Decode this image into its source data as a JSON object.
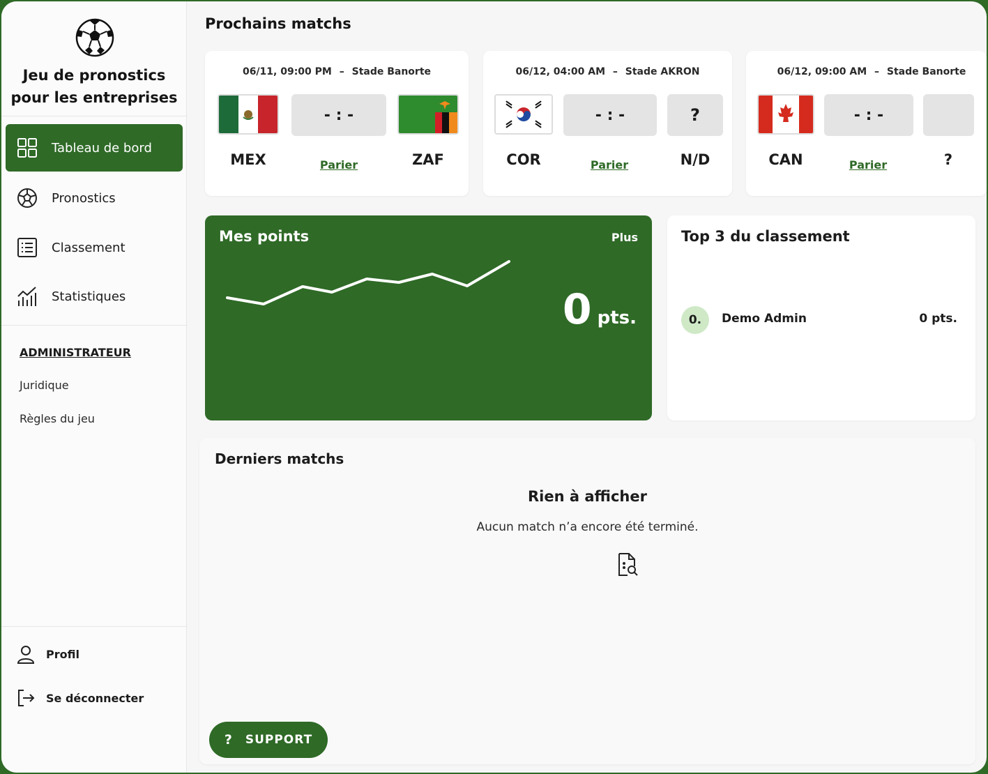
{
  "app": {
    "title_line1": "Jeu de pronostics",
    "title_line2": "pour les entreprises"
  },
  "nav": {
    "items": [
      {
        "label": "Tableau de bord",
        "icon": "dashboard-grid-icon",
        "active": true
      },
      {
        "label": "Pronostics",
        "icon": "soccer-ball-icon",
        "active": false
      },
      {
        "label": "Classement",
        "icon": "list-icon",
        "active": false
      },
      {
        "label": "Statistiques",
        "icon": "chart-icon",
        "active": false
      }
    ]
  },
  "admin": {
    "title": "ADMINISTRATEUR",
    "links": [
      "Juridique",
      "Règles du jeu"
    ]
  },
  "account": {
    "profile": "Profil",
    "logout": "Se déconnecter"
  },
  "upcoming": {
    "title": "Prochains matchs",
    "matches": [
      {
        "date": "06/11, 09:00 PM",
        "stadium": "Stade Banorte",
        "sep": "–",
        "home": "MEX",
        "away": "ZAF",
        "score": "- : -",
        "bet": "Parier"
      },
      {
        "date": "06/12, 04:00 AM",
        "stadium": "Stade AKRON",
        "sep": "–",
        "home": "COR",
        "away": "N/D",
        "score": "- : -",
        "bet": "Parier",
        "away_flag": "?"
      },
      {
        "date": "06/12, 09:00 AM",
        "stadium": "Stade Banorte",
        "sep": "–",
        "home": "CAN",
        "away": "?",
        "score": "- : -",
        "bet": "Parier"
      }
    ]
  },
  "points": {
    "title": "Mes points",
    "more": "Plus",
    "value": "0",
    "unit": "pts.",
    "color": "#2f6a27"
  },
  "top3": {
    "title": "Top 3 du classement",
    "entries": [
      {
        "rank": "0.",
        "name": "Demo Admin",
        "points": "0 pts."
      }
    ]
  },
  "last": {
    "title": "Derniers matchs",
    "empty_title": "Rien à afficher",
    "empty_text": "Aucun match n’a encore été terminé."
  },
  "support": {
    "label": "SUPPORT",
    "icon_text": "?"
  }
}
